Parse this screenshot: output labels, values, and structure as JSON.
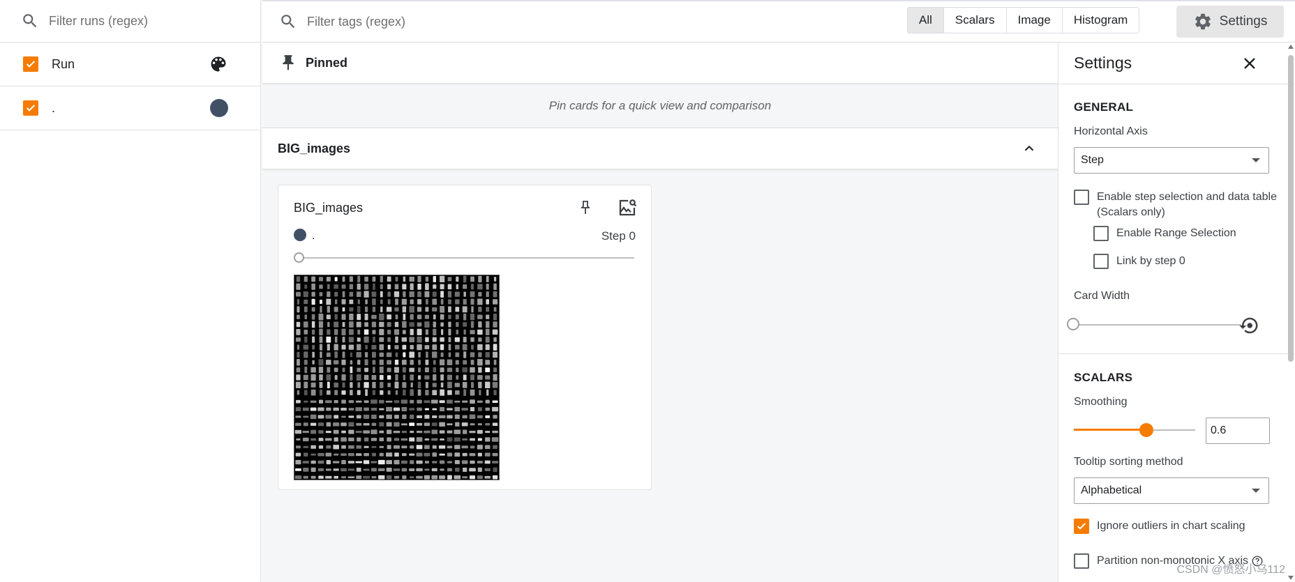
{
  "runs": {
    "filter_placeholder": "Filter runs (regex)",
    "header_label": "Run",
    "items": [
      {
        "name": ".",
        "color": "#425066",
        "checked": true
      }
    ]
  },
  "topbar": {
    "tag_filter_placeholder": "Filter tags (regex)",
    "types": [
      "All",
      "Scalars",
      "Image",
      "Histogram"
    ],
    "active_type": "All",
    "settings_label": "Settings"
  },
  "pinned": {
    "title": "Pinned",
    "empty_message": "Pin cards for a quick view and comparison"
  },
  "group": {
    "title": "BIG_images",
    "card": {
      "title": "BIG_images",
      "run_name": ".",
      "step_label": "Step 0"
    }
  },
  "settings": {
    "title": "Settings",
    "general": {
      "heading": "GENERAL",
      "horizontal_axis_label": "Horizontal Axis",
      "horizontal_axis_value": "Step",
      "step_selection_label": "Enable step selection and data table",
      "step_selection_sub": "(Scalars only)",
      "range_selection_label": "Enable Range Selection",
      "link_by_step_label": "Link by step 0",
      "card_width_label": "Card Width"
    },
    "scalars": {
      "heading": "SCALARS",
      "smoothing_label": "Smoothing",
      "smoothing_value": "0.6",
      "tooltip_sort_label": "Tooltip sorting method",
      "tooltip_sort_value": "Alphabetical",
      "ignore_outliers_label": "Ignore outliers in chart scaling",
      "partition_label": "Partition non-monotonic X axis"
    }
  },
  "watermark": "CSDN @愤怒小乌112",
  "colors": {
    "accent": "#f57c00",
    "run": "#425066"
  }
}
